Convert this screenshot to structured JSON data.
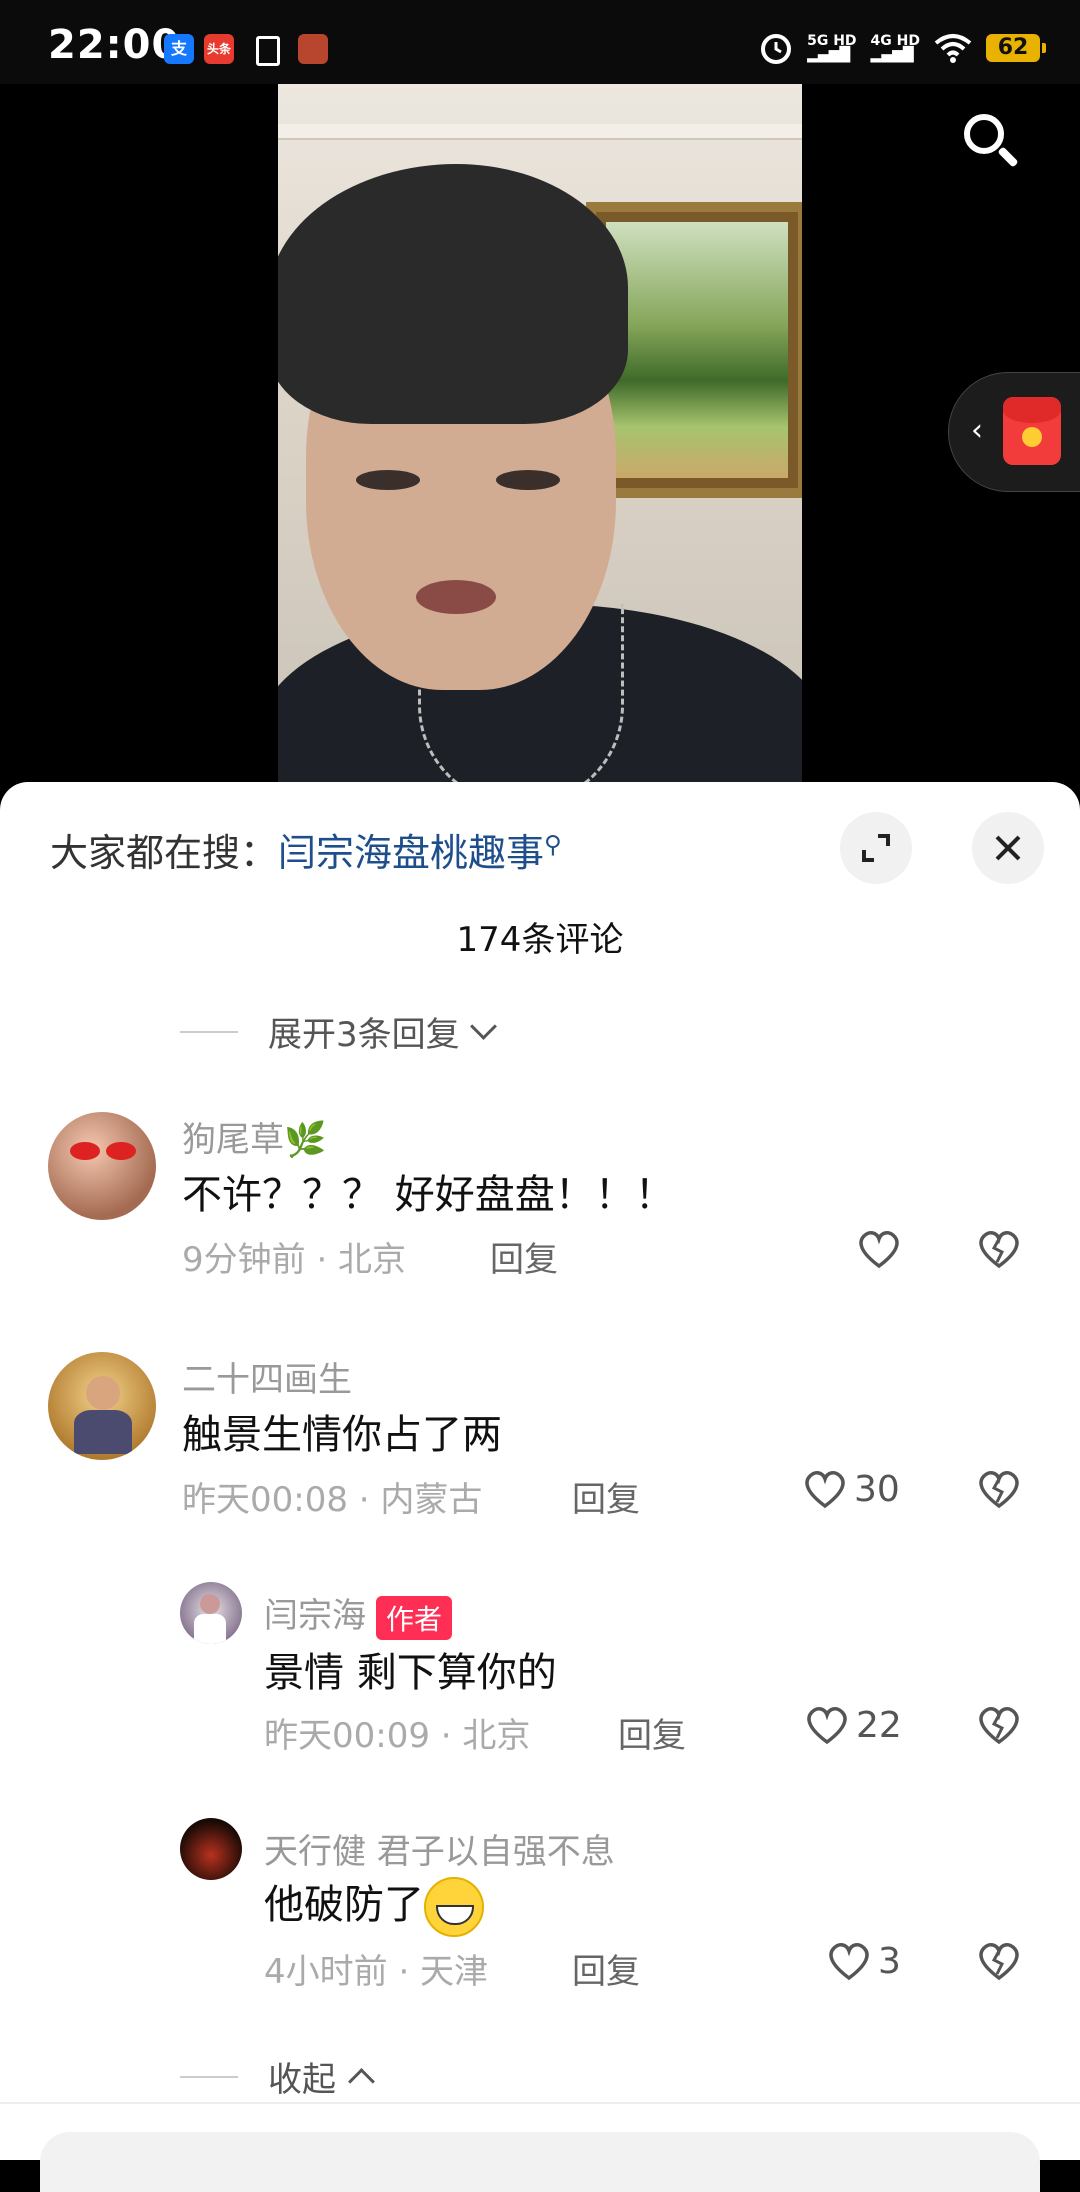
{
  "status_bar": {
    "time": "22:00",
    "apps": [
      "支",
      "头条"
    ],
    "net_top": "5G HD",
    "net_bottom": "4G HD",
    "battery": "62"
  },
  "video": {
    "search_icon": "search-icon",
    "redpacket_icon": "red-packet-icon"
  },
  "panel": {
    "hot_search_prefix": "大家都在搜：",
    "hot_search_term": "闫宗海盘桃趣事",
    "comment_count": "174条评论",
    "expand_replies": "展开3条回复",
    "collapse": "收起"
  },
  "comments": [
    {
      "username": "狗尾草🌿",
      "text": "不许？？？ 好好盘盘！！！",
      "time_loc": "9分钟前 · 北京",
      "reply": "回复",
      "likes": ""
    },
    {
      "username": "二十四画生",
      "text": "触景生情你占了两",
      "time_loc": "昨天00:08 · 内蒙古",
      "reply": "回复",
      "likes": "30"
    },
    {
      "username": "闫宗海",
      "badge": "作者",
      "text": "景情 剩下算你的",
      "time_loc": "昨天00:09 · 北京",
      "reply": "回复",
      "likes": "22"
    },
    {
      "username": "天行健 君子以自强不息",
      "text": "他破防了",
      "time_loc": "4小时前 · 天津",
      "reply": "回复",
      "likes": "3"
    }
  ],
  "colors": {
    "accent_link": "#1e4f8c",
    "author_badge": "#ff2e55",
    "battery": "#e9b200"
  }
}
